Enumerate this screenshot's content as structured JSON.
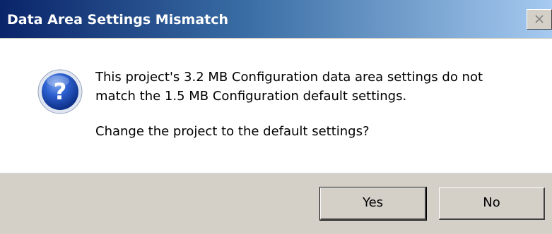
{
  "window": {
    "title": "Data Area Settings Mismatch",
    "close_icon": "close-icon"
  },
  "message": {
    "icon": "question-icon",
    "line1": "This project's 3.2 MB Configuration data area settings do not",
    "line2": "match the 1.5 MB Configuration default settings.",
    "prompt": "Change the project to the default settings?"
  },
  "buttons": {
    "yes_label": "Yes",
    "no_label": "No"
  },
  "colors": {
    "titlebar_start": "#0a246a",
    "titlebar_end": "#a6caf0",
    "button_face": "#d4d0c8",
    "icon_blue": "#1c4fb0"
  }
}
